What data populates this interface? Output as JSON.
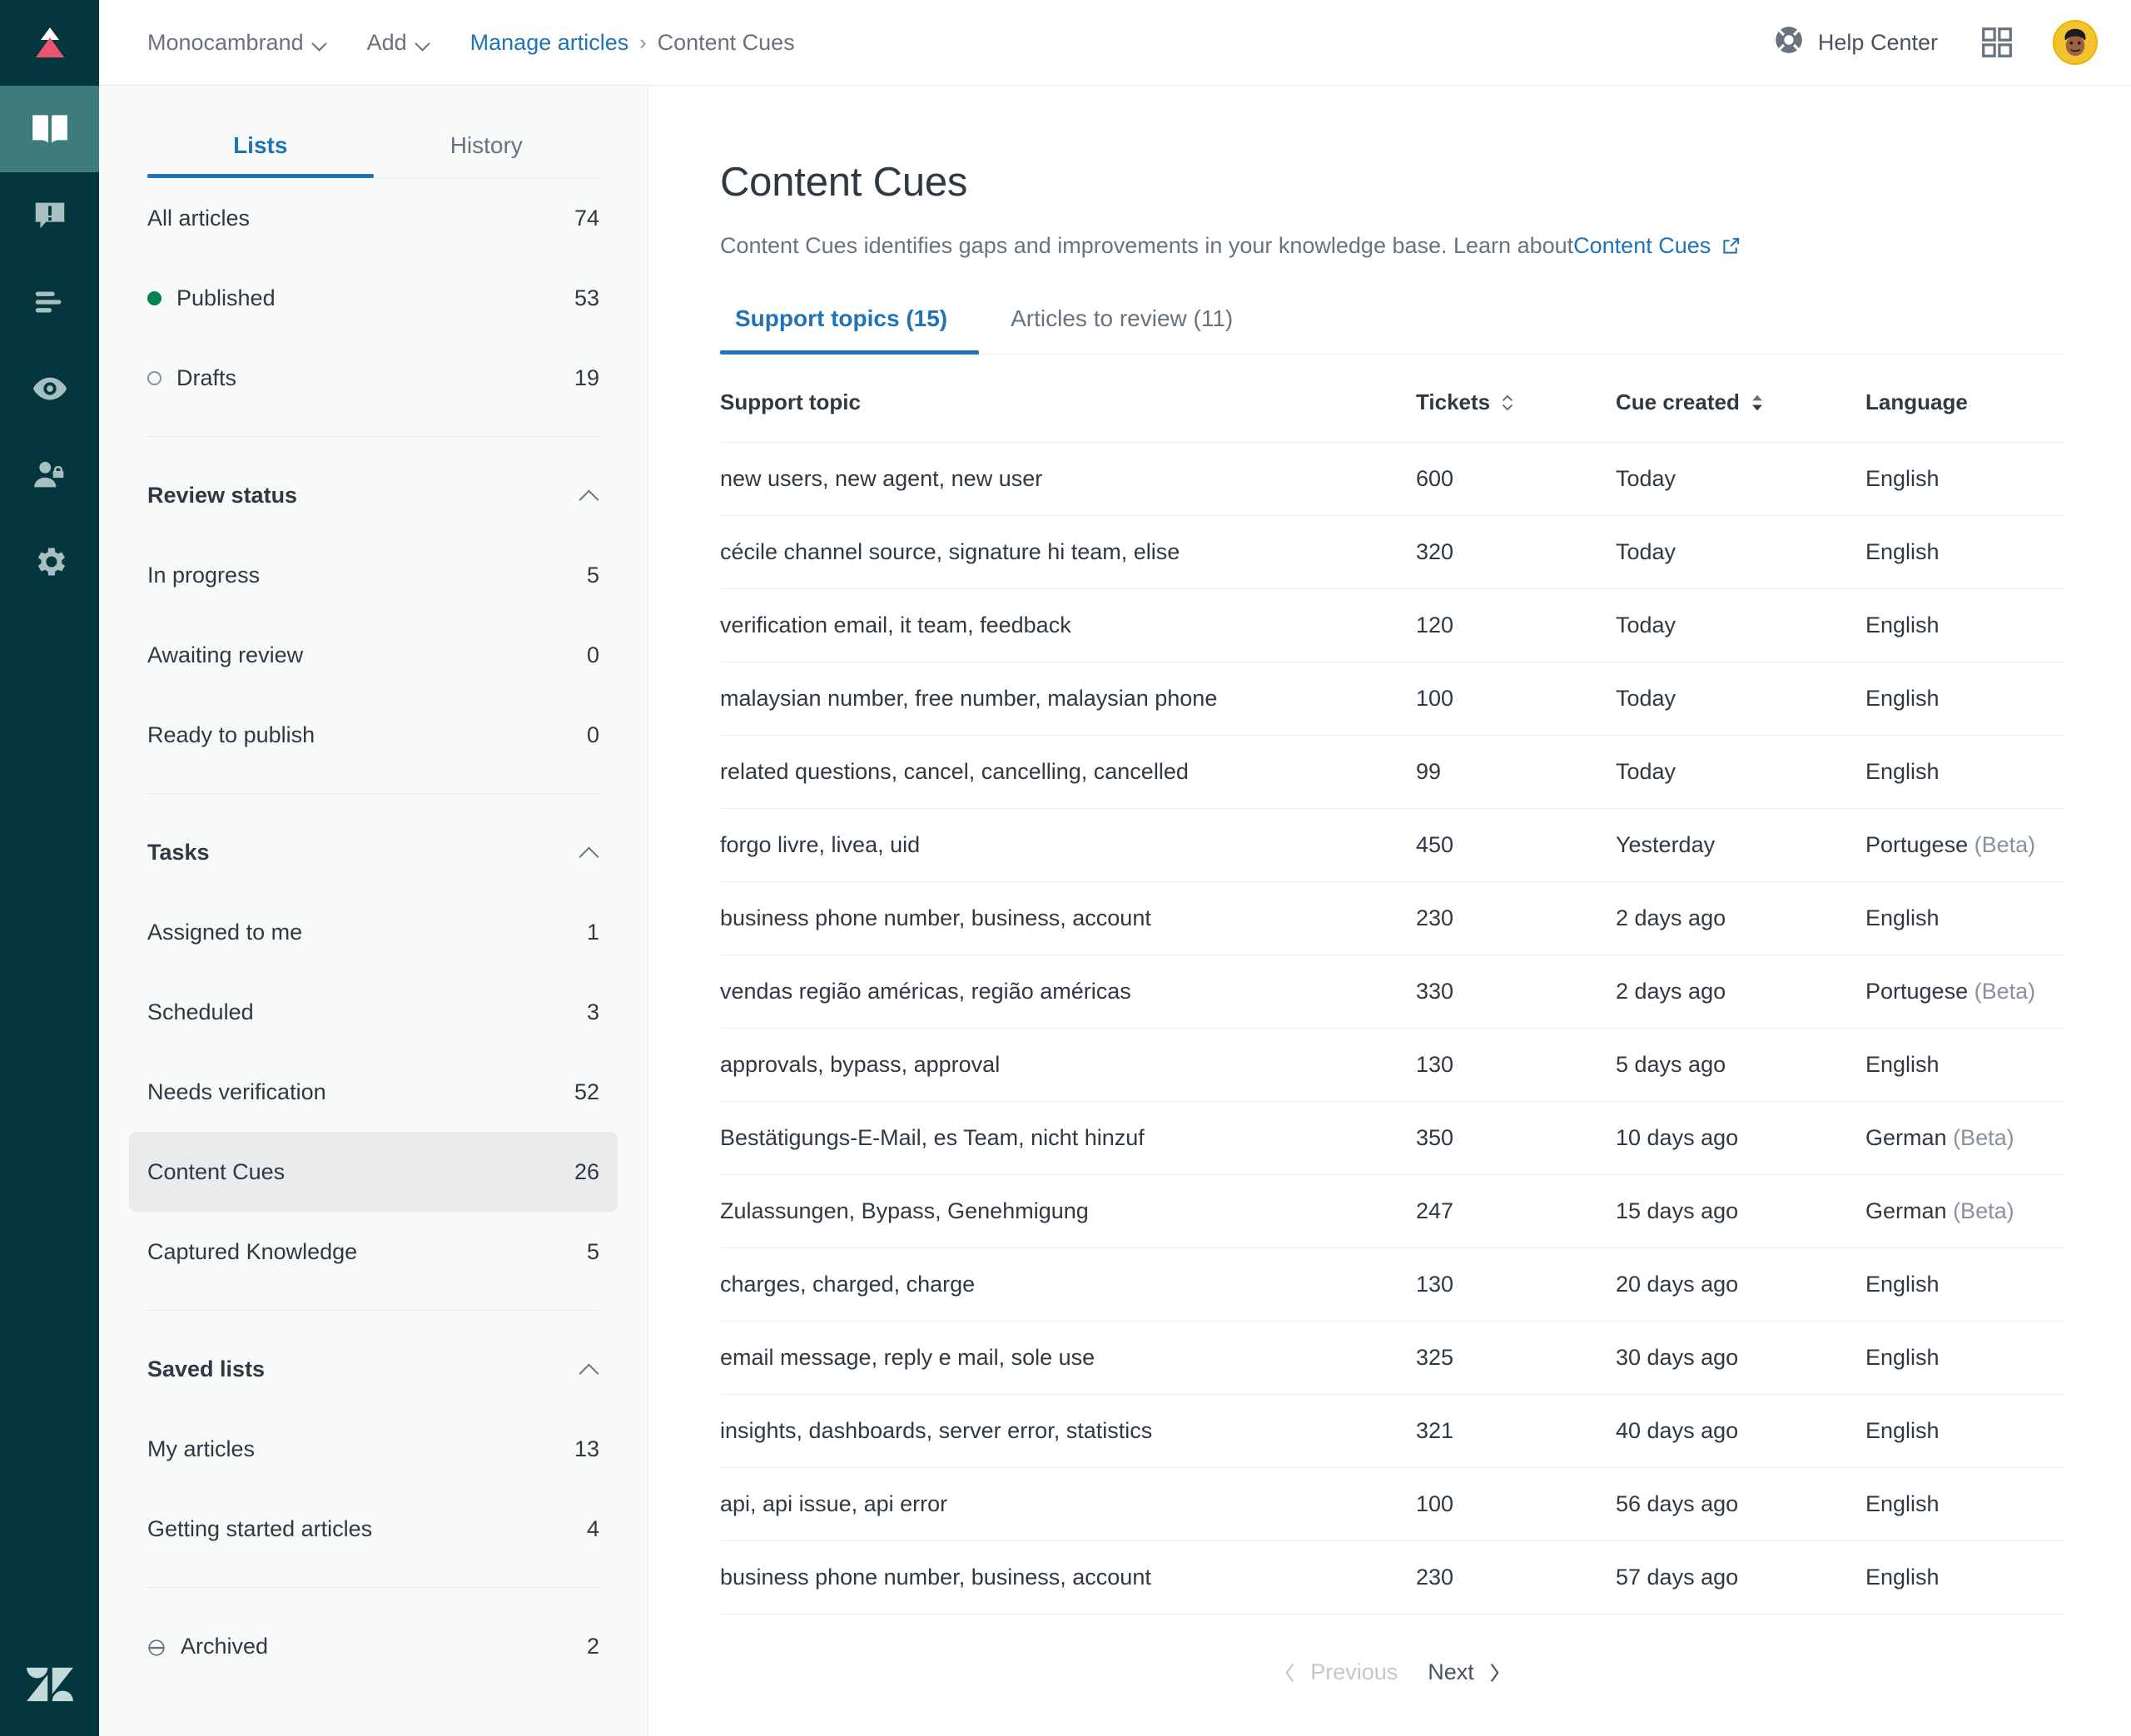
{
  "colors": {
    "rail_bg": "#03363d",
    "rail_active": "#3e7b7d",
    "accent_blue": "#1f73b7",
    "published_green": "#038153",
    "muted_grey": "#68737d",
    "text": "#2f3941",
    "panel_bg": "#f8f9f9",
    "selected_row": "#e9ebed"
  },
  "rail": {
    "logo_name": "brand-logo",
    "items": [
      {
        "icon": "knowledge-book-icon",
        "name": "guide-knowledge",
        "active": true
      },
      {
        "icon": "alert-message-icon",
        "name": "alerts",
        "active": false
      },
      {
        "icon": "list-arrange-icon",
        "name": "arrange-content",
        "active": false
      },
      {
        "icon": "eye-preview-icon",
        "name": "preview",
        "active": false
      },
      {
        "icon": "user-lock-icon",
        "name": "user-permissions",
        "active": false
      },
      {
        "icon": "gear-icon",
        "name": "settings",
        "active": false
      }
    ],
    "footer_icon": "zendesk-logo-icon"
  },
  "topbar": {
    "brand_label": "Monocambrand",
    "add_label": "Add",
    "breadcrumb": {
      "link": "Manage articles",
      "separator": "›",
      "current": "Content Cues"
    },
    "help_label": "Help Center",
    "help_icon": "lifesaver-icon",
    "apps_icon": "grid-apps-icon",
    "avatar_icon": "user-avatar"
  },
  "listpanel": {
    "tabs": [
      {
        "label": "Lists",
        "active": true
      },
      {
        "label": "History",
        "active": false
      }
    ],
    "groups": [
      {
        "header": null,
        "items": [
          {
            "label": "All articles",
            "count": "74",
            "marker": "none",
            "selected": false
          },
          {
            "label": "Published",
            "count": "53",
            "marker": "filled",
            "selected": false
          },
          {
            "label": "Drafts",
            "count": "19",
            "marker": "outline",
            "selected": false
          }
        ]
      },
      {
        "header": "Review status",
        "items": [
          {
            "label": "In progress",
            "count": "5",
            "marker": "none",
            "selected": false
          },
          {
            "label": "Awaiting review",
            "count": "0",
            "marker": "none",
            "selected": false
          },
          {
            "label": "Ready to publish",
            "count": "0",
            "marker": "none",
            "selected": false
          }
        ]
      },
      {
        "header": "Tasks",
        "items": [
          {
            "label": "Assigned to me",
            "count": "1",
            "marker": "none",
            "selected": false
          },
          {
            "label": "Scheduled",
            "count": "3",
            "marker": "none",
            "selected": false
          },
          {
            "label": "Needs verification",
            "count": "52",
            "marker": "none",
            "selected": false
          },
          {
            "label": "Content Cues",
            "count": "26",
            "marker": "none",
            "selected": true
          },
          {
            "label": "Captured Knowledge",
            "count": "5",
            "marker": "none",
            "selected": false
          }
        ]
      },
      {
        "header": "Saved lists",
        "items": [
          {
            "label": "My articles",
            "count": "13",
            "marker": "none",
            "selected": false
          },
          {
            "label": "Getting started articles",
            "count": "4",
            "marker": "none",
            "selected": false
          }
        ]
      },
      {
        "header": null,
        "items": [
          {
            "label": "Archived",
            "count": "2",
            "marker": "archive",
            "selected": false
          }
        ]
      }
    ]
  },
  "main": {
    "title": "Content Cues",
    "description": "Content Cues identifies gaps and improvements in your knowledge base. Learn about ",
    "description_link": "Content Cues",
    "external_link_icon": "external-link-icon",
    "tabs": [
      {
        "label": "Support topics (15)",
        "active": true
      },
      {
        "label": "Articles to review (11)",
        "active": false
      }
    ],
    "table": {
      "columns": [
        {
          "label": "Support topic",
          "sort": "none"
        },
        {
          "label": "Tickets",
          "sort": "sortable"
        },
        {
          "label": "Cue created",
          "sort": "active-desc"
        },
        {
          "label": "Language",
          "sort": "none"
        }
      ],
      "rows": [
        {
          "topic": "new users, new agent, new user",
          "tickets": "600",
          "created": "Today",
          "language": "English",
          "beta": ""
        },
        {
          "topic": "cécile channel source, signature hi team, elise",
          "tickets": "320",
          "created": "Today",
          "language": "English",
          "beta": ""
        },
        {
          "topic": "verification email, it team, feedback",
          "tickets": "120",
          "created": "Today",
          "language": "English",
          "beta": ""
        },
        {
          "topic": "malaysian number, free number, malaysian phone",
          "tickets": "100",
          "created": "Today",
          "language": "English",
          "beta": ""
        },
        {
          "topic": "related questions, cancel, cancelling, cancelled",
          "tickets": "99",
          "created": "Today",
          "language": "English",
          "beta": ""
        },
        {
          "topic": "forgo livre, livea, uid",
          "tickets": "450",
          "created": "Yesterday",
          "language": "Portugese",
          "beta": "(Beta)"
        },
        {
          "topic": "business phone number, business, account",
          "tickets": "230",
          "created": "2 days ago",
          "language": "English",
          "beta": ""
        },
        {
          "topic": "vendas região américas, região américas",
          "tickets": "330",
          "created": "2 days ago",
          "language": "Portugese",
          "beta": "(Beta)"
        },
        {
          "topic": "approvals, bypass, approval",
          "tickets": "130",
          "created": "5 days ago",
          "language": "English",
          "beta": ""
        },
        {
          "topic": "Bestätigungs-E-Mail, es Team, nicht hinzuf",
          "tickets": "350",
          "created": "10 days ago",
          "language": "German",
          "beta": "(Beta)"
        },
        {
          "topic": "Zulassungen, Bypass, Genehmigung",
          "tickets": "247",
          "created": "15 days ago",
          "language": "German",
          "beta": "(Beta)"
        },
        {
          "topic": "charges, charged, charge",
          "tickets": "130",
          "created": "20 days ago",
          "language": "English",
          "beta": ""
        },
        {
          "topic": "email message, reply e mail, sole use",
          "tickets": "325",
          "created": "30 days ago",
          "language": "English",
          "beta": ""
        },
        {
          "topic": "insights, dashboards, server error, statistics",
          "tickets": "321",
          "created": "40 days ago",
          "language": "English",
          "beta": ""
        },
        {
          "topic": "api, api issue, api error",
          "tickets": "100",
          "created": "56 days ago",
          "language": "English",
          "beta": ""
        },
        {
          "topic": "business phone number, business, account",
          "tickets": "230",
          "created": "57 days ago",
          "language": "English",
          "beta": ""
        }
      ]
    },
    "pagination": {
      "previous_label": "Previous",
      "next_label": "Next",
      "previous_enabled": false,
      "next_enabled": true
    }
  }
}
